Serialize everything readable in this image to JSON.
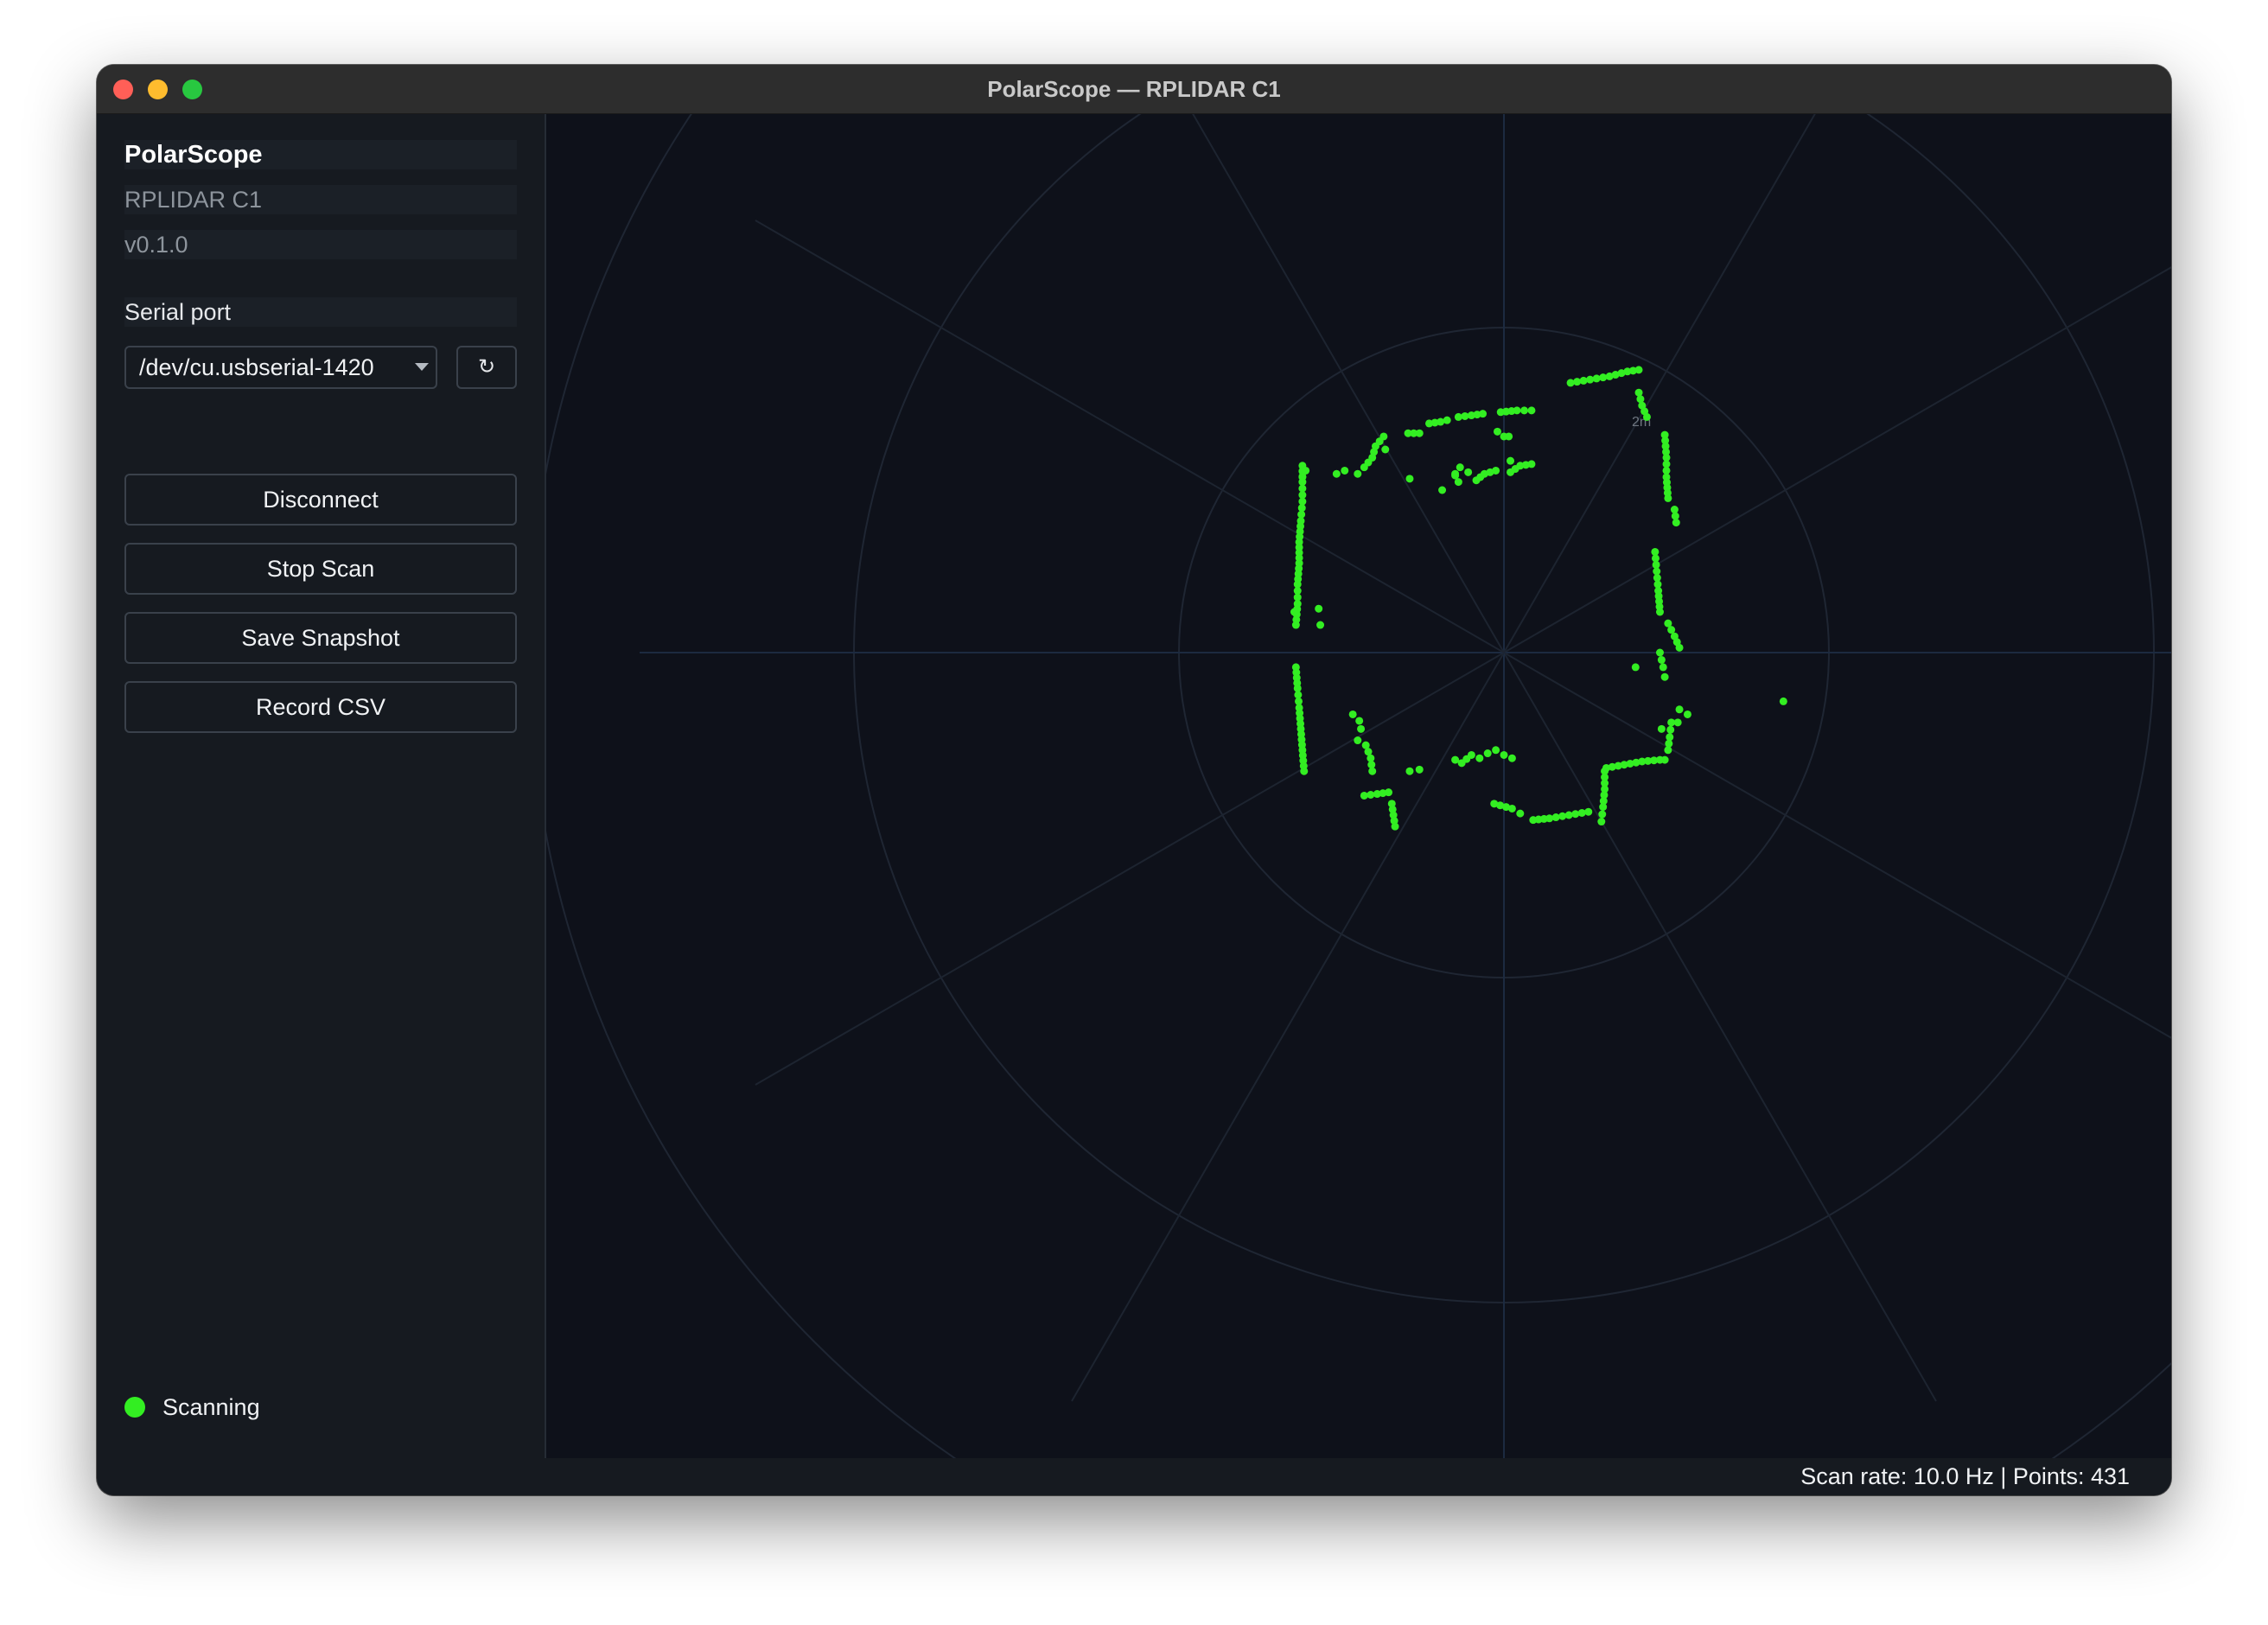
{
  "window": {
    "title": "PolarScope — RPLIDAR C1"
  },
  "sidebar": {
    "app_name": "PolarScope",
    "device": "RPLIDAR C1",
    "version": "v0.1.0",
    "port_label": "Serial port",
    "port_value": "/dev/cu.usbserial-1420",
    "refresh_icon": "↻",
    "buttons": {
      "disconnect": "Disconnect",
      "stop_scan": "Stop Scan",
      "save_snapshot": "Save Snapshot",
      "record_csv": "Record CSV"
    },
    "status": {
      "text": "Scanning",
      "color": "#33ee22"
    }
  },
  "plot": {
    "ring_label": "2m",
    "point_color": "#33ee22",
    "spoke_count": 12,
    "rings_m": [
      1,
      2,
      3
    ]
  },
  "statusbar": {
    "text": "Scan rate: 10.0 Hz | Points: 431"
  },
  "chart_data": {
    "type": "scatter",
    "title": "",
    "units": "m",
    "note": "",
    "segments": [
      [
        [
          -1.28,
          0.17
        ],
        [
          -1.27,
          0.3
        ],
        [
          -1.27,
          0.42
        ],
        [
          -1.26,
          0.55
        ],
        [
          -1.26,
          0.68
        ],
        [
          -1.25,
          0.81
        ],
        [
          -1.24,
          0.93
        ],
        [
          -1.24,
          1.05
        ],
        [
          -1.24,
          1.15
        ]
      ],
      [
        [
          -1.28,
          -0.09
        ],
        [
          -1.27,
          -0.22
        ],
        [
          -1.26,
          -0.34
        ],
        [
          -1.25,
          -0.47
        ],
        [
          -1.24,
          -0.6
        ],
        [
          -1.23,
          -0.73
        ]
      ],
      [
        [
          -1.22,
          1.12
        ],
        [
          -1.24,
          1.08
        ]
      ],
      [
        [
          -0.9,
          1.1
        ],
        [
          -0.86,
          1.14
        ],
        [
          -0.81,
          1.2
        ],
        [
          -0.79,
          1.27
        ],
        [
          -0.74,
          1.33
        ]
      ],
      [
        [
          -1.03,
          1.1
        ],
        [
          -0.98,
          1.12
        ]
      ],
      [
        [
          -0.59,
          1.35
        ],
        [
          -0.52,
          1.35
        ]
      ],
      [
        [
          -0.46,
          1.41
        ],
        [
          -0.39,
          1.42
        ],
        [
          -0.35,
          1.43
        ]
      ],
      [
        [
          -0.28,
          1.45
        ],
        [
          -0.2,
          1.46
        ],
        [
          -0.13,
          1.47
        ]
      ],
      [
        [
          -0.02,
          1.48
        ],
        [
          0.08,
          1.49
        ],
        [
          0.17,
          1.49
        ]
      ],
      [
        [
          0.41,
          1.66
        ],
        [
          0.53,
          1.68
        ],
        [
          0.65,
          1.7
        ],
        [
          0.76,
          1.73
        ],
        [
          0.83,
          1.74
        ]
      ],
      [
        [
          0.83,
          1.6
        ],
        [
          0.85,
          1.52
        ],
        [
          0.88,
          1.45
        ]
      ],
      [
        [
          0.99,
          1.34
        ],
        [
          1.0,
          1.2
        ],
        [
          1.0,
          1.08
        ],
        [
          1.01,
          0.95
        ]
      ],
      [
        [
          1.05,
          0.88
        ],
        [
          1.06,
          0.8
        ]
      ],
      [
        [
          0.93,
          0.62
        ],
        [
          0.94,
          0.5
        ],
        [
          0.95,
          0.38
        ],
        [
          0.96,
          0.25
        ]
      ],
      [
        [
          1.01,
          0.18
        ],
        [
          1.05,
          0.1
        ],
        [
          1.08,
          0.03
        ]
      ],
      [
        [
          0.96,
          0.0
        ],
        [
          0.98,
          -0.09
        ],
        [
          0.99,
          -0.15
        ]
      ],
      [
        [
          1.03,
          -0.43
        ],
        [
          1.02,
          -0.52
        ],
        [
          1.01,
          -0.6
        ],
        [
          0.99,
          -0.66
        ]
      ],
      [
        [
          1.08,
          -0.35
        ],
        [
          1.13,
          -0.38
        ]
      ],
      [
        [
          0.96,
          -0.66
        ],
        [
          0.85,
          -0.67
        ],
        [
          0.74,
          -0.69
        ],
        [
          0.63,
          -0.71
        ]
      ],
      [
        [
          0.62,
          -0.73
        ],
        [
          0.62,
          -0.84
        ],
        [
          0.61,
          -0.95
        ],
        [
          0.6,
          -1.04
        ]
      ],
      [
        [
          0.52,
          -0.98
        ],
        [
          0.4,
          -1.0
        ],
        [
          0.28,
          -1.02
        ],
        [
          0.18,
          -1.03
        ]
      ],
      [
        [
          0.1,
          -0.99
        ],
        [
          0.05,
          -0.96
        ],
        [
          -0.06,
          -0.93
        ]
      ],
      [
        [
          -0.1,
          -0.62
        ],
        [
          -0.05,
          -0.6
        ],
        [
          0.0,
          -0.63
        ],
        [
          0.05,
          -0.65
        ]
      ],
      [
        [
          -0.3,
          -0.66
        ],
        [
          -0.26,
          -0.68
        ],
        [
          -0.2,
          -0.63
        ],
        [
          -0.15,
          -0.65
        ]
      ],
      [
        [
          -0.58,
          -0.73
        ],
        [
          -0.52,
          -0.72
        ]
      ],
      [
        [
          -0.86,
          -0.88
        ],
        [
          -0.78,
          -0.87
        ],
        [
          -0.71,
          -0.86
        ]
      ],
      [
        [
          -0.69,
          -0.93
        ],
        [
          -0.68,
          -1.0
        ],
        [
          -0.67,
          -1.07
        ]
      ],
      [
        [
          -0.93,
          -0.38
        ],
        [
          -0.89,
          -0.42
        ],
        [
          -0.88,
          -0.47
        ]
      ],
      [
        [
          -0.9,
          -0.54
        ],
        [
          -0.85,
          -0.57
        ],
        [
          -0.82,
          -0.65
        ],
        [
          -0.81,
          -0.73
        ]
      ],
      [
        [
          -0.17,
          1.06
        ],
        [
          -0.12,
          1.1
        ],
        [
          -0.05,
          1.12
        ]
      ],
      [
        [
          0.04,
          1.11
        ],
        [
          0.1,
          1.15
        ],
        [
          0.17,
          1.16
        ]
      ],
      [
        [
          -0.3,
          1.09
        ],
        [
          -0.27,
          1.14
        ]
      ]
    ],
    "isolated_points": [
      [
        -1.29,
        0.25
      ],
      [
        -1.14,
        0.27
      ],
      [
        -1.13,
        0.17
      ],
      [
        -0.73,
        1.25
      ],
      [
        -0.58,
        1.07
      ],
      [
        -0.38,
        1.0
      ],
      [
        -0.3,
        1.1
      ],
      [
        -0.22,
        1.11
      ],
      [
        -0.04,
        1.36
      ],
      [
        0.0,
        1.33
      ],
      [
        0.03,
        1.33
      ],
      [
        0.04,
        1.18
      ],
      [
        0.81,
        -0.09
      ],
      [
        1.07,
        -0.43
      ],
      [
        0.97,
        -0.47
      ],
      [
        1.72,
        -0.3
      ],
      [
        -0.28,
        1.05
      ]
    ]
  }
}
